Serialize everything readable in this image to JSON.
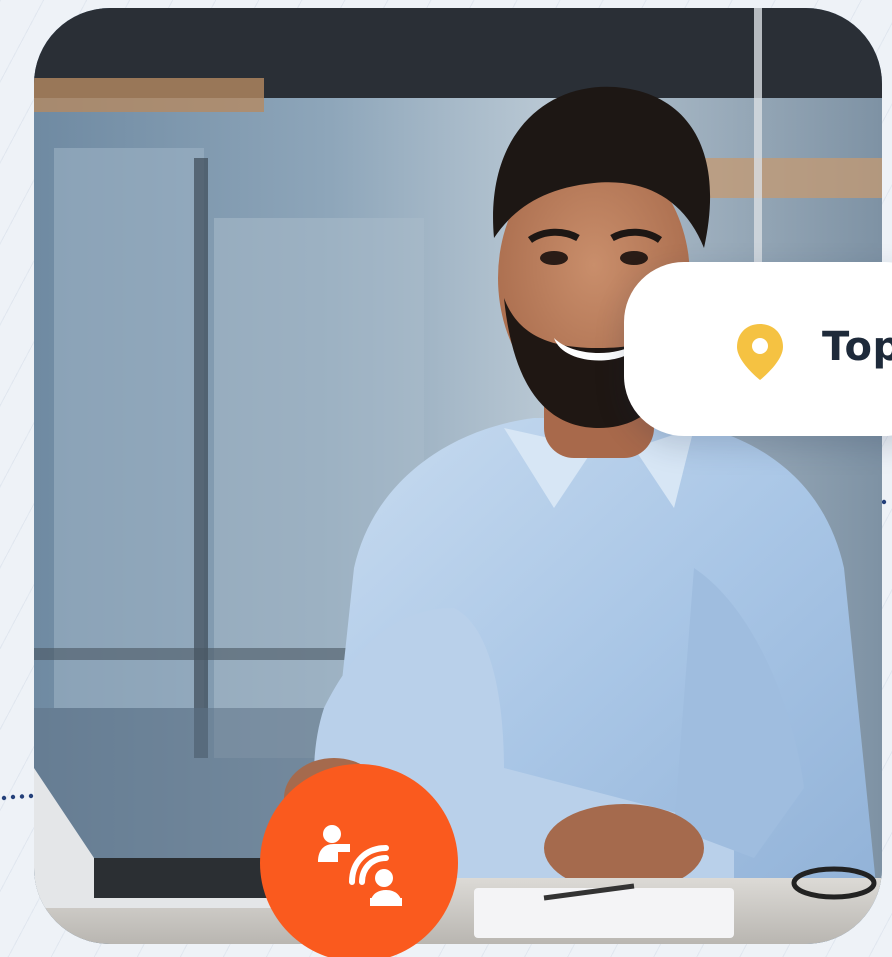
{
  "location_badge": {
    "text": "Top",
    "icon": "map-pin-icon",
    "icon_color": "#f5c242"
  },
  "contact_badge": {
    "icon": "person-signal-icon",
    "background_color": "#fa5a1e"
  },
  "colors": {
    "page_background": "#eef2f7",
    "pill_background": "#ffffff",
    "text": "#1e2a3a",
    "dot_line": "#24407a"
  }
}
